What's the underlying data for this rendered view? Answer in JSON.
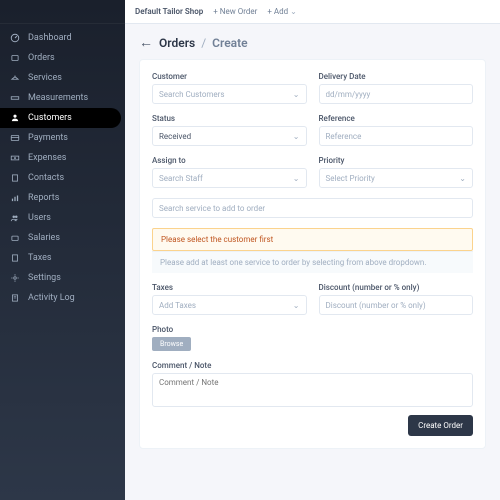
{
  "topbar": {
    "shop_name": "Default Tailor Shop",
    "new_order": "New Order",
    "add": "Add"
  },
  "sidebar": {
    "items": [
      {
        "label": "Dashboard"
      },
      {
        "label": "Orders"
      },
      {
        "label": "Services"
      },
      {
        "label": "Measurements"
      },
      {
        "label": "Customers"
      },
      {
        "label": "Payments"
      },
      {
        "label": "Expenses"
      },
      {
        "label": "Contacts"
      },
      {
        "label": "Reports"
      },
      {
        "label": "Users"
      },
      {
        "label": "Salaries"
      },
      {
        "label": "Taxes"
      },
      {
        "label": "Settings"
      },
      {
        "label": "Activity Log"
      }
    ]
  },
  "breadcrumb": {
    "parent": "Orders",
    "sep": "/",
    "current": "Create"
  },
  "form": {
    "customer_label": "Customer",
    "customer_ph": "Search Customers",
    "delivery_label": "Delivery Date",
    "delivery_ph": "dd/mm/yyyy",
    "status_label": "Status",
    "status_value": "Received",
    "reference_label": "Reference",
    "reference_ph": "Reference",
    "assign_label": "Assign to",
    "assign_ph": "Search Staff",
    "priority_label": "Priority",
    "priority_ph": "Select Priority",
    "service_ph": "Search service to add to order",
    "warn_msg": "Please select the customer first",
    "info_msg": "Please add at least one service to order by selecting from above dropdown.",
    "taxes_label": "Taxes",
    "taxes_ph": "Add Taxes",
    "discount_label": "Discount (number or % only)",
    "discount_ph": "Discount (number or % only)",
    "photo_label": "Photo",
    "browse": "Browse",
    "comment_label": "Comment / Note",
    "comment_ph": "Comment / Note",
    "submit": "Create Order"
  }
}
